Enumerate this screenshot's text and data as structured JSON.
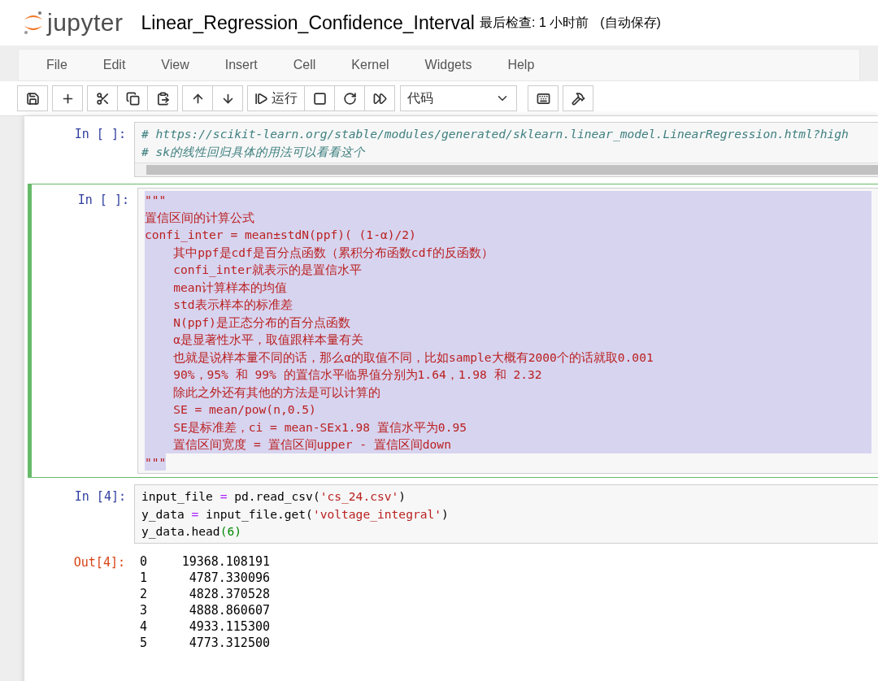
{
  "header": {
    "logo": "jupyter",
    "title": "Linear_Regression_Confidence_Interval",
    "checkpoint": "最后检查: 1 小时前",
    "autosave": "(自动保存)"
  },
  "menu": [
    "File",
    "Edit",
    "View",
    "Insert",
    "Cell",
    "Kernel",
    "Widgets",
    "Help"
  ],
  "toolbar": {
    "run_label": "运行",
    "cell_type": "代码"
  },
  "cells": [
    {
      "prompt": "In [ ]:",
      "selected": false,
      "text_selected": false,
      "scrollbar": true,
      "lines": [
        [
          {
            "kind": "comment",
            "text": "# https://scikit-learn.org/stable/modules/generated/sklearn.linear_model.LinearRegression.html?high"
          }
        ],
        [
          {
            "kind": "comment",
            "text": "# sk的线性回归具体的用法可以看看这个"
          }
        ]
      ]
    },
    {
      "prompt": "In [ ]:",
      "selected": true,
      "text_selected": true,
      "scrollbar": false,
      "lines": [
        [
          {
            "kind": "string",
            "text": "\"\"\""
          }
        ],
        [
          {
            "kind": "string",
            "text": "置信区间的计算公式"
          }
        ],
        [
          {
            "kind": "string",
            "text": "confi_inter = mean±stdN(ppf)( (1-α)/2)"
          }
        ],
        [
          {
            "kind": "string",
            "text": "    其中ppf是cdf是百分点函数（累积分布函数cdf的反函数）"
          }
        ],
        [
          {
            "kind": "string",
            "text": "    confi_inter就表示的是置信水平"
          }
        ],
        [
          {
            "kind": "string",
            "text": "    mean计算样本的均值"
          }
        ],
        [
          {
            "kind": "string",
            "text": "    std表示样本的标准差"
          }
        ],
        [
          {
            "kind": "string",
            "text": "    N(ppf)是正态分布的百分点函数"
          }
        ],
        [
          {
            "kind": "string",
            "text": "    α是显著性水平，取值跟样本量有关"
          }
        ],
        [
          {
            "kind": "string",
            "text": "    也就是说样本量不同的话，那么α的取值不同，比如sample大概有2000个的话就取0.001"
          }
        ],
        [
          {
            "kind": "string",
            "text": "    90%，95% 和 99% 的置信水平临界值分别为1.64，1.98 和 2.32"
          }
        ],
        [
          {
            "kind": "string",
            "text": "    除此之外还有其他的方法是可以计算的"
          }
        ],
        [
          {
            "kind": "string",
            "text": "    SE = mean/pow(n,0.5)"
          }
        ],
        [
          {
            "kind": "string",
            "text": "    SE是标准差，ci = mean-SEx1.98 置信水平为0.95"
          }
        ],
        [
          {
            "kind": "string",
            "text": "    置信区间宽度 = 置信区间upper - 置信区间down"
          }
        ],
        [
          {
            "kind": "string",
            "text": "\"\"\""
          }
        ]
      ]
    },
    {
      "prompt": "In [4]:",
      "selected": false,
      "text_selected": false,
      "scrollbar": false,
      "lines": [
        [
          {
            "kind": "name",
            "text": "input_file "
          },
          {
            "kind": "operator",
            "text": "="
          },
          {
            "kind": "name",
            "text": " pd.read_csv("
          },
          {
            "kind": "string",
            "text": "'cs_24.csv'"
          },
          {
            "kind": "name",
            "text": ")"
          }
        ],
        [
          {
            "kind": "name",
            "text": "y_data "
          },
          {
            "kind": "operator",
            "text": "="
          },
          {
            "kind": "name",
            "text": " input_file.get("
          },
          {
            "kind": "string",
            "text": "'voltage_integral'"
          },
          {
            "kind": "name",
            "text": ")"
          }
        ],
        [
          {
            "kind": "name",
            "text": "y_data.head"
          },
          {
            "kind": "number",
            "text": "(6)"
          }
        ]
      ],
      "output": {
        "prompt": "Out[4]:",
        "rows": [
          {
            "index": "0",
            "value": "19368.108191"
          },
          {
            "index": "1",
            "value": "4787.330096"
          },
          {
            "index": "2",
            "value": "4828.370528"
          },
          {
            "index": "3",
            "value": "4888.860607"
          },
          {
            "index": "4",
            "value": "4933.115300"
          },
          {
            "index": "5",
            "value": "4773.312500"
          }
        ]
      }
    }
  ]
}
